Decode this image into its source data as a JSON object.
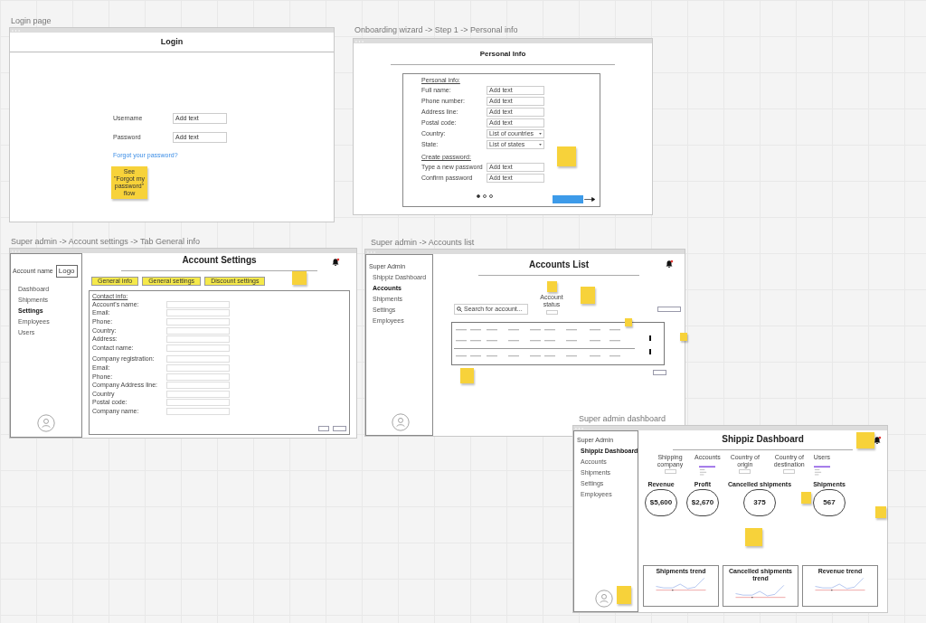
{
  "frames": [
    {
      "kind": "login",
      "label": "Login page",
      "title": "Login",
      "fields": [
        {
          "label": "Username",
          "value": "Add text"
        },
        {
          "label": "Password",
          "value": "Add text"
        }
      ],
      "link": "Forgot your password?",
      "note": "See \"Forgot my password\" flow"
    },
    {
      "kind": "wizard",
      "label": "Onboarding wizard -> Step 1 ->  Personal info",
      "title": "Personal Info",
      "sections": [
        {
          "heading": "Personal info:",
          "fields": [
            {
              "kind": "text",
              "label": "Full name:",
              "value": "Add text"
            },
            {
              "kind": "text",
              "label": "Phone number:",
              "value": "Add text"
            },
            {
              "kind": "text",
              "label": "Address line:",
              "value": "Add text"
            },
            {
              "kind": "text",
              "label": "Postal code:",
              "value": "Add text"
            },
            {
              "kind": "select",
              "label": "Country:",
              "value": "List of countries"
            },
            {
              "kind": "select",
              "label": "State:",
              "value": "List of states"
            }
          ]
        },
        {
          "heading": "Create password:",
          "fields": [
            {
              "kind": "text",
              "label": "Type a new password",
              "value": "Add text"
            },
            {
              "kind": "text",
              "label": "Confirm password",
              "value": "Add text"
            }
          ]
        }
      ],
      "steps": [
        {
          "selected": true
        },
        {
          "selected": false
        },
        {
          "selected": false
        }
      ]
    },
    {
      "kind": "settings",
      "label": "Super admin -> Account settings -> Tab General info",
      "account_name": "Account name",
      "logo": "Logo",
      "nav": [
        {
          "label": "Dashboard",
          "selected": false
        },
        {
          "label": "Shipments",
          "selected": false
        },
        {
          "label": "Settings",
          "selected": true
        },
        {
          "label": "Employees",
          "selected": false
        },
        {
          "label": "Users",
          "selected": false
        }
      ],
      "title": "Account Settings",
      "tabs": [
        "General info",
        "General settings",
        "Discount settings"
      ],
      "section": "Contact info:",
      "groups": [
        [
          "Account's name:",
          "Email:",
          "Phone:",
          "Country:",
          "Address:",
          "Contact name:"
        ],
        [
          "Company registration:",
          "Email:",
          "Phone:",
          "Company Address line:",
          "Country",
          "Postal code:",
          "Company name:"
        ]
      ]
    },
    {
      "kind": "accounts",
      "label": "Super admin -> Accounts list",
      "sidebar_title": "Super Admin",
      "nav": [
        {
          "label": "Shippiz Dashboard",
          "selected": false
        },
        {
          "label": "Accounts",
          "selected": true
        },
        {
          "label": "Shipments",
          "selected": false
        },
        {
          "label": "Settings",
          "selected": false
        },
        {
          "label": "Employees",
          "selected": false
        }
      ],
      "title": "Accounts List",
      "filter_label": "Account status",
      "search_placeholder": "Search for account..."
    },
    {
      "kind": "dashboard",
      "label": "Super admin dashboard",
      "sidebar_title": "Super Admin",
      "nav": [
        {
          "label": "Shippiz Dashboard",
          "selected": true
        },
        {
          "label": "Accounts",
          "selected": false
        },
        {
          "label": "Shipments",
          "selected": false
        },
        {
          "label": "Settings",
          "selected": false
        },
        {
          "label": "Employees",
          "selected": false
        }
      ],
      "title": "Shippiz Dashboard",
      "filters": [
        {
          "kind": "dropdown",
          "label": "Shipping company"
        },
        {
          "kind": "list",
          "label": "Accounts"
        },
        {
          "kind": "dropdown",
          "label": "Country of origin"
        },
        {
          "kind": "dropdown",
          "label": "Country of destination"
        },
        {
          "kind": "list",
          "label": "Users"
        }
      ],
      "kpis": [
        {
          "label": "Revenue",
          "value": "$5,600"
        },
        {
          "label": "Profit",
          "value": "$2,670"
        },
        {
          "label": "Cancelled shipments",
          "value": "375"
        },
        {
          "label": "Shipments",
          "value": "567"
        }
      ],
      "trends": [
        {
          "title": "Shipments trend"
        },
        {
          "title": "Cancelled shipments trend"
        },
        {
          "title": "Revenue trend"
        }
      ]
    }
  ]
}
